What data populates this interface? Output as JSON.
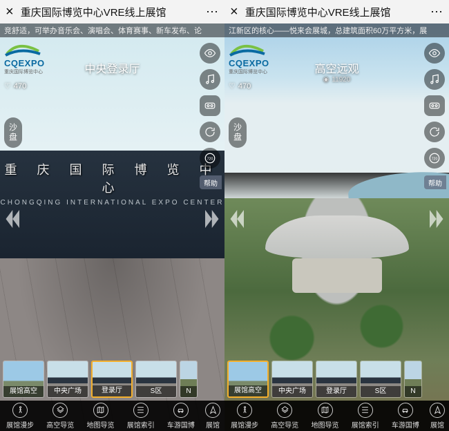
{
  "app_title": "重庆国际博览中心VRE线上展馆",
  "logo": {
    "brand": "CQEXPO",
    "sub": "重庆国际博览中心"
  },
  "building_sign": {
    "cn": "重 庆 国 际 博 览 中 心",
    "en": "CHONGQING INTERNATIONAL EXPO CENTER"
  },
  "pill_label": "沙盘",
  "help_label": "帮助",
  "left": {
    "banner": "竞舒适，可举办音乐会、演唱会、体育赛事、新车发布、论",
    "scene_title": "中央登录厅",
    "likes": "470"
  },
  "right": {
    "banner": "江新区的核心——悦来会展城，总建筑面积60万平方米，展",
    "scene_title": "高空远观",
    "likes": "470",
    "views": "11920"
  },
  "thumbs": [
    {
      "label": "展馆高空",
      "variant": "sky"
    },
    {
      "label": "中央广场",
      "variant": "plaza"
    },
    {
      "label": "登录厅",
      "variant": "plaza"
    },
    {
      "label": "S区",
      "variant": "plaza"
    },
    {
      "label": "N",
      "variant": "land"
    }
  ],
  "left_active_thumb": 2,
  "right_active_thumb": 0,
  "botnav": [
    {
      "label": "展馆漫步",
      "icon": "walk"
    },
    {
      "label": "高空导览",
      "icon": "aerial"
    },
    {
      "label": "地图导览",
      "icon": "map"
    },
    {
      "label": "展馆索引",
      "icon": "index"
    },
    {
      "label": "车游国博",
      "icon": "car"
    },
    {
      "label": "展馆导航",
      "icon": "nav"
    }
  ]
}
